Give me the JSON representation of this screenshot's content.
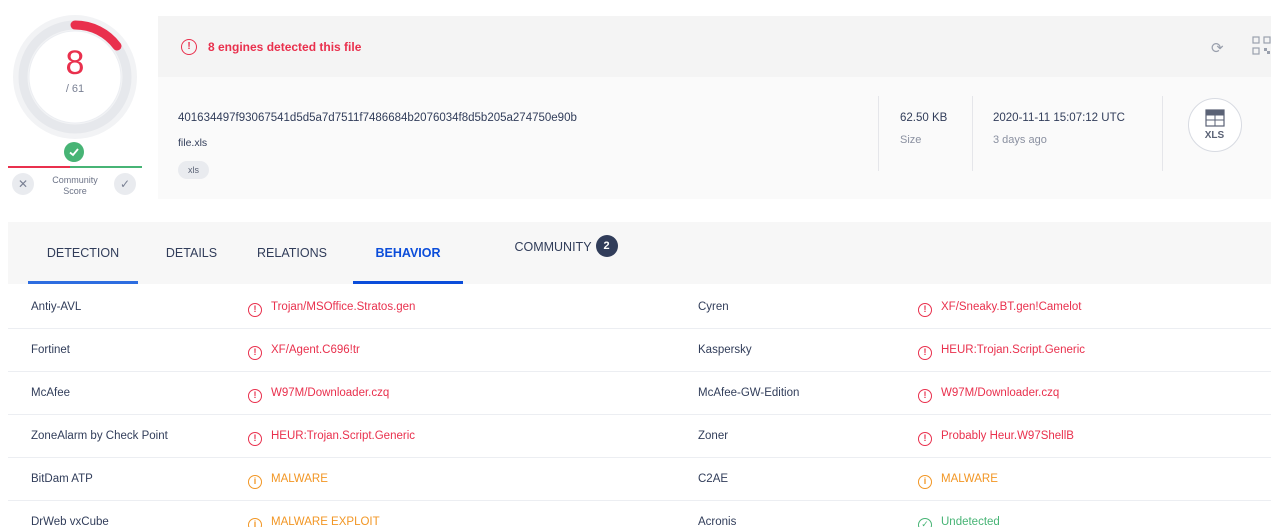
{
  "score": {
    "detected": "8",
    "total": "/ 61",
    "community_label": "Community\nScore",
    "colors": {
      "malicious": "#e9304d",
      "harmless": "#47b475"
    }
  },
  "header": {
    "detection_message": "8 engines detected this file",
    "hash": "401634497f93067541d5d5a7d7511f7486684b2076034f8d5b205a274750e90b",
    "filename": "file.xls",
    "tag": "xls",
    "size_value": "62.50 KB",
    "size_label": "Size",
    "date_value": "2020-11-11 15:07:12 UTC",
    "date_label": "3 days ago",
    "filetype": "XLS"
  },
  "tabs": [
    {
      "label": "DETECTION",
      "active": false
    },
    {
      "label": "DETAILS",
      "active": false
    },
    {
      "label": "RELATIONS",
      "active": false
    },
    {
      "label": "BEHAVIOR",
      "active": true
    },
    {
      "label": "COMMUNITY",
      "badge": "2",
      "active": false
    }
  ],
  "detections": [
    {
      "left": {
        "engine": "Antiy-AVL",
        "result": "Trojan/MSOffice.Stratos.gen",
        "status": "malicious"
      },
      "right": {
        "engine": "Cyren",
        "result": "XF/Sneaky.BT.gen!Camelot",
        "status": "malicious"
      }
    },
    {
      "left": {
        "engine": "Fortinet",
        "result": "XF/Agent.C696!tr",
        "status": "malicious"
      },
      "right": {
        "engine": "Kaspersky",
        "result": "HEUR:Trojan.Script.Generic",
        "status": "malicious"
      }
    },
    {
      "left": {
        "engine": "McAfee",
        "result": "W97M/Downloader.czq",
        "status": "malicious"
      },
      "right": {
        "engine": "McAfee-GW-Edition",
        "result": "W97M/Downloader.czq",
        "status": "malicious"
      }
    },
    {
      "left": {
        "engine": "ZoneAlarm by Check Point",
        "result": "HEUR:Trojan.Script.Generic",
        "status": "malicious"
      },
      "right": {
        "engine": "Zoner",
        "result": "Probably Heur.W97ShellB",
        "status": "malicious"
      }
    },
    {
      "left": {
        "engine": "BitDam ATP",
        "result": "MALWARE",
        "status": "suspicious"
      },
      "right": {
        "engine": "C2AE",
        "result": "MALWARE",
        "status": "suspicious"
      }
    },
    {
      "left": {
        "engine": "DrWeb vxCube",
        "result": "MALWARE EXPLOIT",
        "status": "suspicious"
      },
      "right": {
        "engine": "Acronis",
        "result": "Undetected",
        "status": "undetected"
      }
    }
  ],
  "icons": {
    "alert": "alert-circle-icon",
    "refresh": "refresh-icon",
    "qr": "qr-code-icon",
    "check": "check-circle-icon",
    "close": "close-icon",
    "file": "xls-file-icon"
  }
}
